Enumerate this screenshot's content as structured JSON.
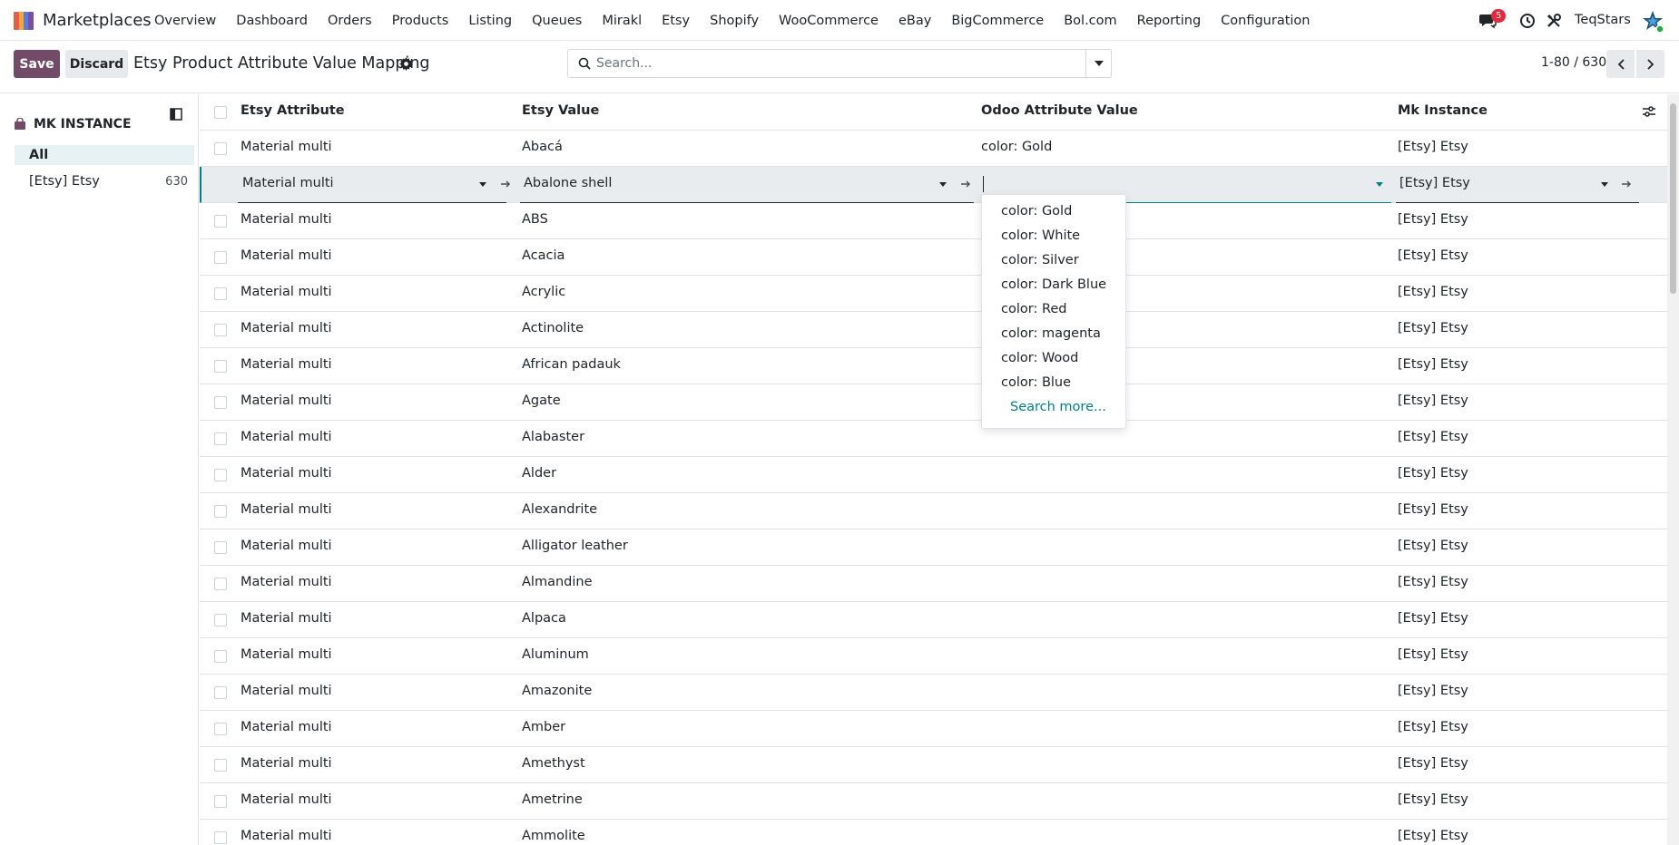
{
  "navbar": {
    "app_name": "Marketplaces",
    "menu": [
      "Overview",
      "Dashboard",
      "Orders",
      "Products",
      "Listing",
      "Queues",
      "Mirakl",
      "Etsy",
      "Shopify",
      "WooCommerce",
      "eBay",
      "BigCommerce",
      "Bol.com",
      "Reporting",
      "Configuration"
    ],
    "messages_badge": "5",
    "company": "TeqStars"
  },
  "control": {
    "save_label": "Save",
    "discard_label": "Discard",
    "title": "Etsy Product Attribute Value Mapping",
    "search_placeholder": "Search...",
    "pager": "1-80 / 630"
  },
  "sidebar": {
    "header": "MK INSTANCE",
    "all_label": "All",
    "items": [
      {
        "label": "[Etsy] Etsy",
        "count": "630"
      }
    ]
  },
  "table": {
    "columns": [
      "Etsy Attribute",
      "Etsy Value",
      "Odoo Attribute Value",
      "Mk Instance"
    ],
    "rows": [
      {
        "attribute": "Material multi",
        "value": "Abacá",
        "odoo": "color: Gold",
        "instance": "[Etsy] Etsy"
      },
      {
        "attribute": "Material multi",
        "value": "Abalone shell",
        "odoo": "",
        "instance": "[Etsy] Etsy"
      },
      {
        "attribute": "Material multi",
        "value": "ABS",
        "odoo": "",
        "instance": "[Etsy] Etsy"
      },
      {
        "attribute": "Material multi",
        "value": "Acacia",
        "odoo": "",
        "instance": "[Etsy] Etsy"
      },
      {
        "attribute": "Material multi",
        "value": "Acrylic",
        "odoo": "",
        "instance": "[Etsy] Etsy"
      },
      {
        "attribute": "Material multi",
        "value": "Actinolite",
        "odoo": "",
        "instance": "[Etsy] Etsy"
      },
      {
        "attribute": "Material multi",
        "value": "African padauk",
        "odoo": "",
        "instance": "[Etsy] Etsy"
      },
      {
        "attribute": "Material multi",
        "value": "Agate",
        "odoo": "",
        "instance": "[Etsy] Etsy"
      },
      {
        "attribute": "Material multi",
        "value": "Alabaster",
        "odoo": "",
        "instance": "[Etsy] Etsy"
      },
      {
        "attribute": "Material multi",
        "value": "Alder",
        "odoo": "",
        "instance": "[Etsy] Etsy"
      },
      {
        "attribute": "Material multi",
        "value": "Alexandrite",
        "odoo": "",
        "instance": "[Etsy] Etsy"
      },
      {
        "attribute": "Material multi",
        "value": "Alligator leather",
        "odoo": "",
        "instance": "[Etsy] Etsy"
      },
      {
        "attribute": "Material multi",
        "value": "Almandine",
        "odoo": "",
        "instance": "[Etsy] Etsy"
      },
      {
        "attribute": "Material multi",
        "value": "Alpaca",
        "odoo": "",
        "instance": "[Etsy] Etsy"
      },
      {
        "attribute": "Material multi",
        "value": "Aluminum",
        "odoo": "",
        "instance": "[Etsy] Etsy"
      },
      {
        "attribute": "Material multi",
        "value": "Amazonite",
        "odoo": "",
        "instance": "[Etsy] Etsy"
      },
      {
        "attribute": "Material multi",
        "value": "Amber",
        "odoo": "",
        "instance": "[Etsy] Etsy"
      },
      {
        "attribute": "Material multi",
        "value": "Amethyst",
        "odoo": "",
        "instance": "[Etsy] Etsy"
      },
      {
        "attribute": "Material multi",
        "value": "Ametrine",
        "odoo": "",
        "instance": "[Etsy] Etsy"
      },
      {
        "attribute": "Material multi",
        "value": "Ammolite",
        "odoo": "",
        "instance": "[Etsy] Etsy"
      }
    ]
  },
  "dropdown": {
    "options": [
      "color: Gold",
      "color: White",
      "color: Silver",
      "color: Dark Blue",
      "color: Red",
      "color: magenta",
      "color: Wood",
      "color: Blue"
    ],
    "search_more": "Search more..."
  },
  "colors": {
    "primary": "#714b67",
    "accent": "#017e84",
    "badge": "#e4283d"
  }
}
